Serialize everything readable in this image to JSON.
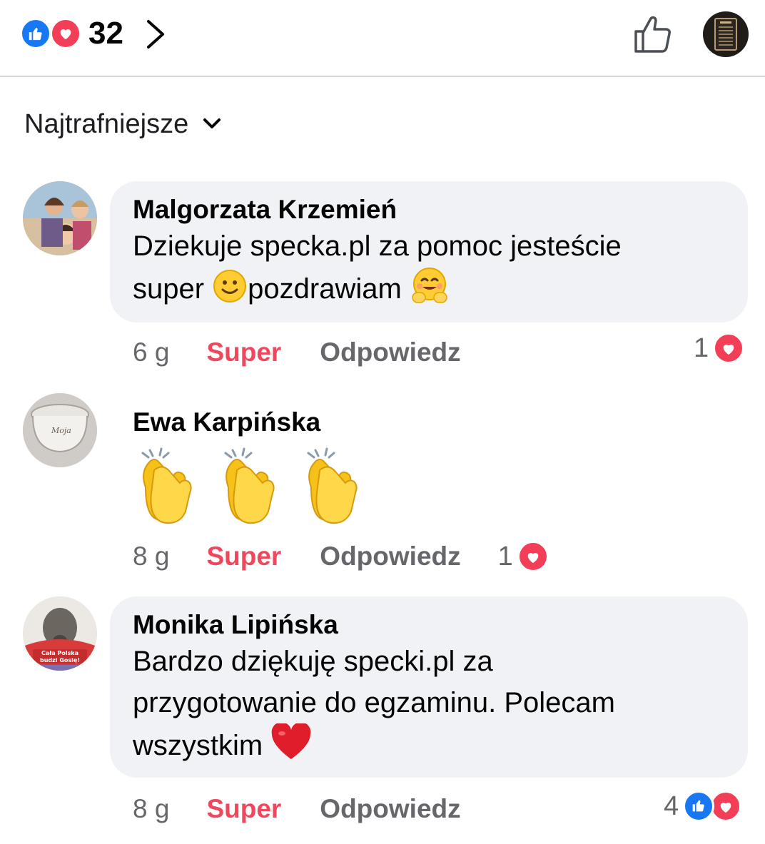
{
  "header": {
    "reaction_count": "32",
    "reaction_icons": [
      "like-icon",
      "love-icon"
    ]
  },
  "sort": {
    "label": "Najtrafniejsze"
  },
  "comments": [
    {
      "author": "Malgorzata Krzemień",
      "text_line1": "Dziekuje specka.pl za pomoc jesteście",
      "text_line2a": "super ",
      "text_line2b": "pozdrawiam ",
      "time": "6 g",
      "react_action": "Super",
      "reply_action": "Odpowiedz",
      "reaction_count": "1"
    },
    {
      "author": "Ewa Karpińska",
      "text": "👏👏👏",
      "time": "8 g",
      "react_action": "Super",
      "reply_action": "Odpowiedz",
      "reaction_count": "1"
    },
    {
      "author": "Monika Lipińska",
      "text_line1": "Bardzo dziękuję specki.pl za",
      "text_line2": "przygotowanie do egzaminu. Polecam",
      "text_line3": "wszystkim ",
      "time": "8 g",
      "react_action": "Super",
      "reply_action": "Odpowiedz",
      "reaction_count": "4"
    }
  ],
  "colors": {
    "like": "#1877f2",
    "love": "#f33e58",
    "super": "#f0475d",
    "bubble": "#f0f2f5",
    "meta": "#65676b"
  }
}
